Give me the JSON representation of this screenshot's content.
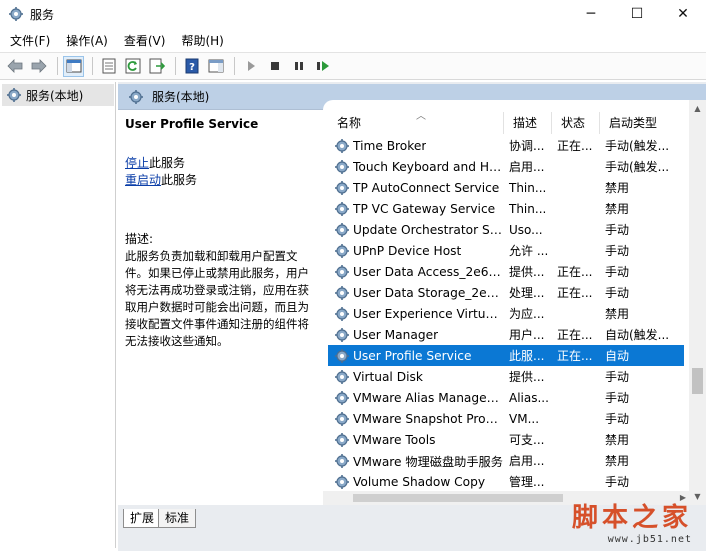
{
  "window": {
    "title": "服务",
    "minimize": "─",
    "maximize": "☐",
    "close": "✕"
  },
  "menu": {
    "items": [
      "文件(F)",
      "操作(A)",
      "查看(V)",
      "帮助(H)"
    ]
  },
  "tree": {
    "root_label": "服务(本地)"
  },
  "header": {
    "title": "服务(本地)"
  },
  "details": {
    "service_name": "User Profile Service",
    "stop_link": "停止",
    "stop_suffix": "此服务",
    "restart_link": "重启动",
    "restart_suffix": "此服务",
    "desc_label": "描述:",
    "description": "此服务负责加载和卸载用户配置文件。如果已停止或禁用此服务，用户将无法再成功登录或注销，应用在获取用户数据时可能会出问题，而且为接收配置文件事件通知注册的组件将无法接收这些通知。"
  },
  "list": {
    "columns": [
      "名称",
      "描述",
      "状态",
      "启动类型"
    ],
    "rows": [
      {
        "name": "Time Broker",
        "desc": "协调...",
        "status": "正在...",
        "start": "手动(触发..."
      },
      {
        "name": "Touch Keyboard and Ha...",
        "desc": "启用...",
        "status": "",
        "start": "手动(触发..."
      },
      {
        "name": "TP AutoConnect Service",
        "desc": "Thin...",
        "status": "",
        "start": "禁用"
      },
      {
        "name": "TP VC Gateway Service",
        "desc": "Thin...",
        "status": "",
        "start": "禁用"
      },
      {
        "name": "Update Orchestrator Ser...",
        "desc": "Uso...",
        "status": "",
        "start": "手动"
      },
      {
        "name": "UPnP Device Host",
        "desc": "允许 ...",
        "status": "",
        "start": "手动"
      },
      {
        "name": "User Data Access_2e621",
        "desc": "提供...",
        "status": "正在...",
        "start": "手动"
      },
      {
        "name": "User Data Storage_2e621",
        "desc": "处理...",
        "status": "正在...",
        "start": "手动"
      },
      {
        "name": "User Experience Virtualiz...",
        "desc": "为应...",
        "status": "",
        "start": "禁用"
      },
      {
        "name": "User Manager",
        "desc": "用户...",
        "status": "正在...",
        "start": "自动(触发..."
      },
      {
        "name": "User Profile Service",
        "desc": "此服...",
        "status": "正在...",
        "start": "自动"
      },
      {
        "name": "Virtual Disk",
        "desc": "提供...",
        "status": "",
        "start": "手动"
      },
      {
        "name": "VMware Alias Manager a...",
        "desc": "Alias...",
        "status": "",
        "start": "手动"
      },
      {
        "name": "VMware Snapshot Provid...",
        "desc": "VM...",
        "status": "",
        "start": "手动"
      },
      {
        "name": "VMware Tools",
        "desc": "可支...",
        "status": "",
        "start": "禁用"
      },
      {
        "name": "VMware 物理磁盘助手服务",
        "desc": "启用...",
        "status": "",
        "start": "禁用"
      },
      {
        "name": "Volume Shadow Copy",
        "desc": "管理...",
        "status": "",
        "start": "手动"
      }
    ],
    "selected_index": 10
  },
  "tabs": {
    "extended": "扩展",
    "standard": "标准"
  },
  "watermark": {
    "logo_text": "脚本之家",
    "url": "www.jb51.net"
  },
  "colors": {
    "selection": "#0b78d4",
    "header_band": "#bdd0e6",
    "link": "#0b3ea8"
  }
}
